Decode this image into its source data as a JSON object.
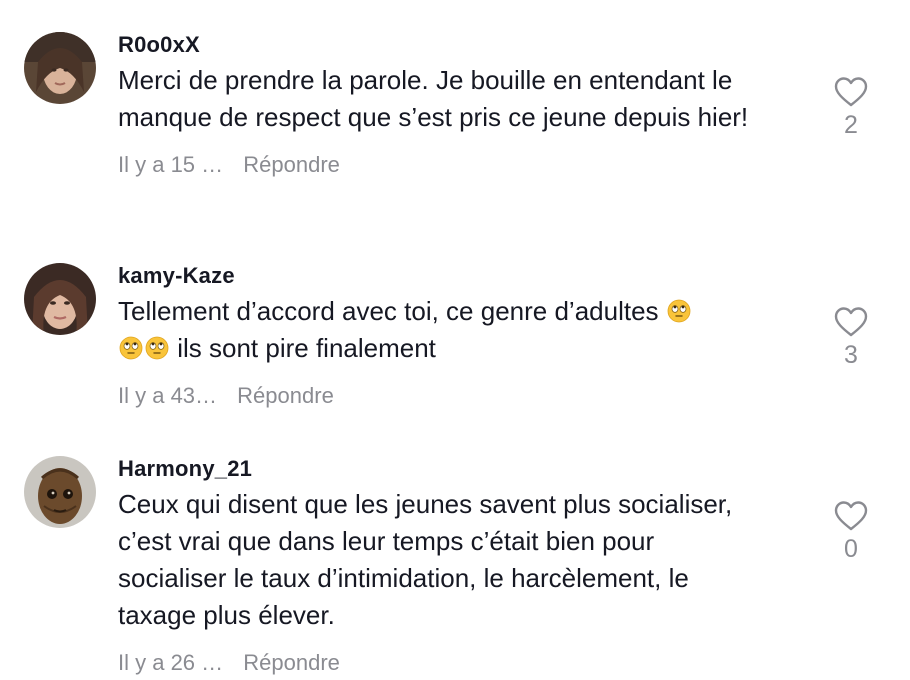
{
  "comments": [
    {
      "username": "R0o0xX",
      "text": "Merci de prendre la parole. Je bouille en entendant le manque de respect que s’est pris ce jeune depuis hier!",
      "time": "Il y a 15 …",
      "reply_label": "Répondre",
      "likes": "2",
      "avatar": "woman-portrait-avatar"
    },
    {
      "username": "kamy-Kaze",
      "text_before": "Tellement d’accord avec toi, ce genre d’adultes ",
      "text_after": " ils sont pire finalement",
      "emoji": "face-with-rolling-eyes",
      "time": "Il y a 43…",
      "reply_label": "Répondre",
      "likes": "3",
      "avatar": "woman-portrait-avatar"
    },
    {
      "username": "Harmony_21",
      "text": "Ceux qui disent que les jeunes savent plus socialiser, c’est vrai que dans leur temps c’était bien pour socialiser le taux d’intimidation, le harcèlement, le taxage plus élever.",
      "time": "Il y a 26 …",
      "reply_label": "Répondre",
      "likes": "0",
      "avatar": "groot-avatar"
    }
  ],
  "colors": {
    "text": "#161823",
    "muted": "#8a8b91",
    "background": "#ffffff"
  }
}
